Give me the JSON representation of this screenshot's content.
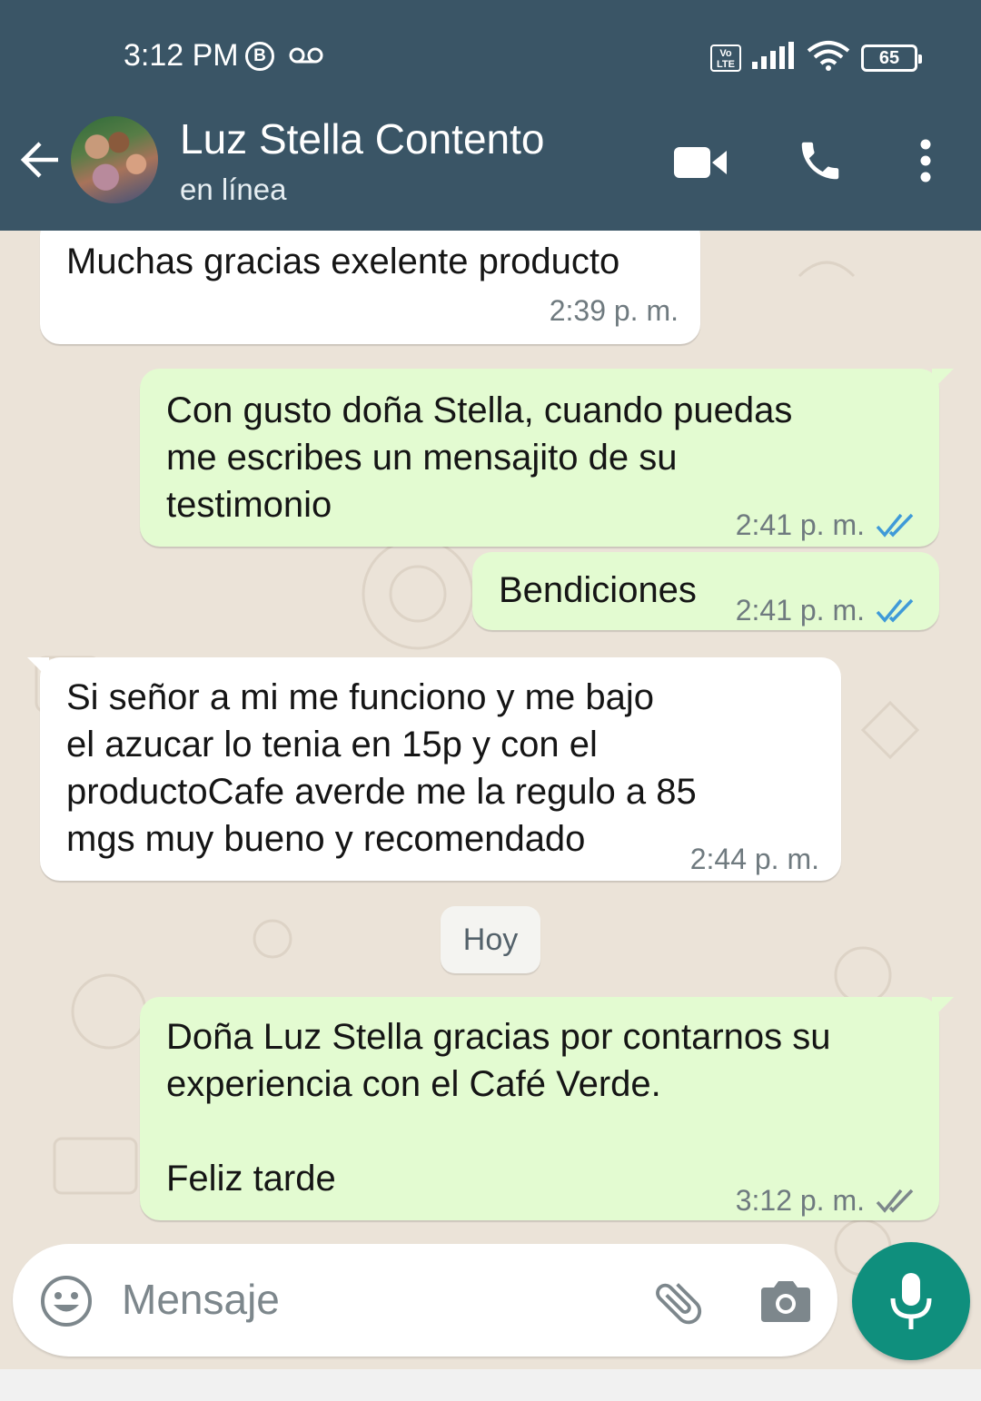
{
  "status_bar": {
    "time": "3:12 PM",
    "network_badge": "B",
    "volte": "Vo LTE",
    "battery": "65",
    "icons": [
      "voicemail-icon",
      "signal-icon",
      "wifi-icon",
      "battery-icon"
    ]
  },
  "header": {
    "contact_name": "Luz Stella Contento",
    "contact_status": "en línea",
    "icons": [
      "back-arrow-icon",
      "video-call-icon",
      "phone-call-icon",
      "more-options-icon"
    ],
    "background_color": "#3a5566"
  },
  "messages": [
    {
      "direction": "in",
      "text": "Muchas gracias exelente producto",
      "time": "2:39 p. m.",
      "read": false
    },
    {
      "direction": "out",
      "text": "Con gusto doña Stella, cuando puedas\nme escribes un mensajito de su\ntestimonio",
      "time": "2:41 p. m.",
      "read": true
    },
    {
      "direction": "out",
      "text": "Bendiciones",
      "time": "2:41 p. m.",
      "read": true
    },
    {
      "direction": "in",
      "text": "Si señor a mi me funciono y me bajo\nel azucar lo tenia en 15p y con el\nproductoCafe averde me la regulo a 85\nmgs muy bueno y recomendado",
      "time": "2:44 p. m.",
      "read": false
    },
    {
      "direction": "out",
      "text": "Doña Luz Stella gracias por contarnos su\nexperiencia con el Café Verde.\n\nFeliz tarde",
      "time": "3:12 p. m.",
      "read": false
    }
  ],
  "day_separator": "Hoy",
  "composer": {
    "placeholder": "Mensaje",
    "icons": [
      "emoji-icon",
      "attach-icon",
      "camera-icon",
      "microphone-icon"
    ]
  },
  "colors": {
    "incoming_bubble": "#ffffff",
    "outgoing_bubble": "#e3fbd1",
    "read_check": "#3f9ad8",
    "delivered_check": "#7d878c",
    "mic_button": "#0f8f7d"
  }
}
